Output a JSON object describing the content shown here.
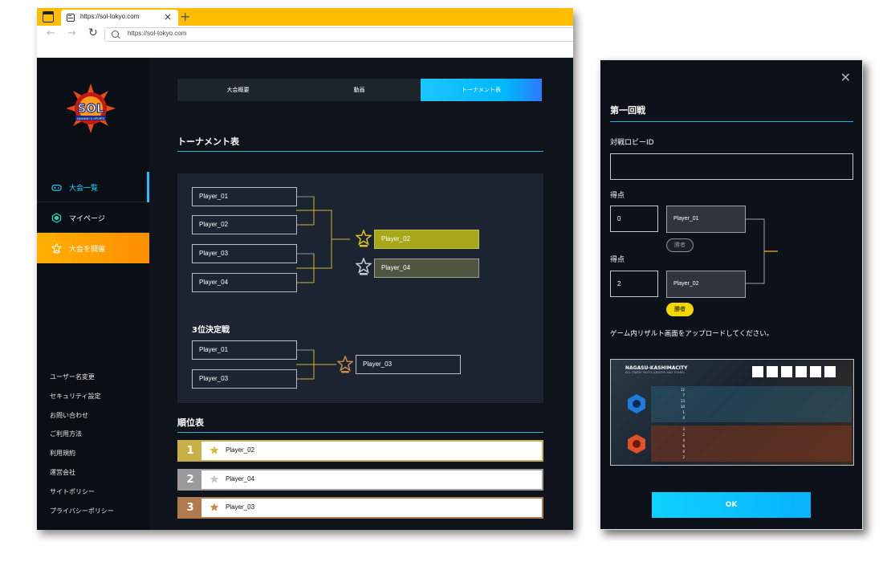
{
  "browser": {
    "tab_title": "https://sol-tokyo.com",
    "url": "https://sol-tokyo.com"
  },
  "sidebar": {
    "logo_text": "SOL",
    "logo_subtext": "SAIKANO E-SPORTS",
    "menu": [
      {
        "label": "大会一覧",
        "icon": "gamepad-icon",
        "state": "active"
      },
      {
        "label": "マイページ",
        "icon": "shield-icon",
        "state": "normal"
      },
      {
        "label": "大会を開催",
        "icon": "star-trophy-icon",
        "state": "highlight"
      }
    ],
    "footer_links": [
      "ユーザー名変更",
      "セキュリティ設定",
      "お問い合わせ",
      "ご利用方法",
      "利用規約",
      "運営会社",
      "サイトポリシー",
      "プライバシーポリシー"
    ]
  },
  "tabs": [
    {
      "label": "大会概要",
      "active": false
    },
    {
      "label": "動画",
      "active": false
    },
    {
      "label": "トーナメント表",
      "active": true
    }
  ],
  "tournament": {
    "title": "トーナメント表",
    "round1": [
      "Player_01",
      "Player_02",
      "Player_03",
      "Player_04"
    ],
    "finals": [
      {
        "name": "Player_02",
        "result": "winner"
      },
      {
        "name": "Player_04",
        "result": "runner-up"
      }
    ],
    "third_place_title": "3位決定戦",
    "third_place_players": [
      "Player_01",
      "Player_03"
    ],
    "third_place_winner": "Player_03"
  },
  "ranking": {
    "title": "順位表",
    "rows": [
      {
        "rank": "1",
        "name": "Player_02",
        "color": "#c9b046"
      },
      {
        "rank": "2",
        "name": "Player_04",
        "color": "#9a9a9a"
      },
      {
        "rank": "3",
        "name": "Player_03",
        "color": "#b07a50"
      }
    ]
  },
  "modal": {
    "title": "第一回戦",
    "lobby_label": "対戦ロビーID",
    "lobby_value": "",
    "score_label": "得点",
    "matches": [
      {
        "score": "0",
        "player": "Player_01",
        "badge": "勝者",
        "won": false
      },
      {
        "score": "2",
        "player": "Player_02",
        "badge": "勝者",
        "won": true
      }
    ],
    "upload_text": "ゲーム内リザルト画面をアップロードしてください。",
    "screenshot": {
      "map_name": "NAGASU-KASHIMACITY",
      "sub": "KILL ENEMY PILOTS (DEATHS AND TITANS)",
      "team_a_scores": [
        "12",
        "7",
        "13",
        "10",
        "1",
        "0"
      ],
      "team_b_scores": [
        "3",
        "2",
        "4",
        "6",
        "0",
        "2"
      ]
    },
    "ok_label": "OK"
  },
  "colors": {
    "accent_cyan": "#1fc5ff",
    "gold": "#a8a61a",
    "orange": "#ffa200",
    "bg_dark": "#0e131c"
  }
}
